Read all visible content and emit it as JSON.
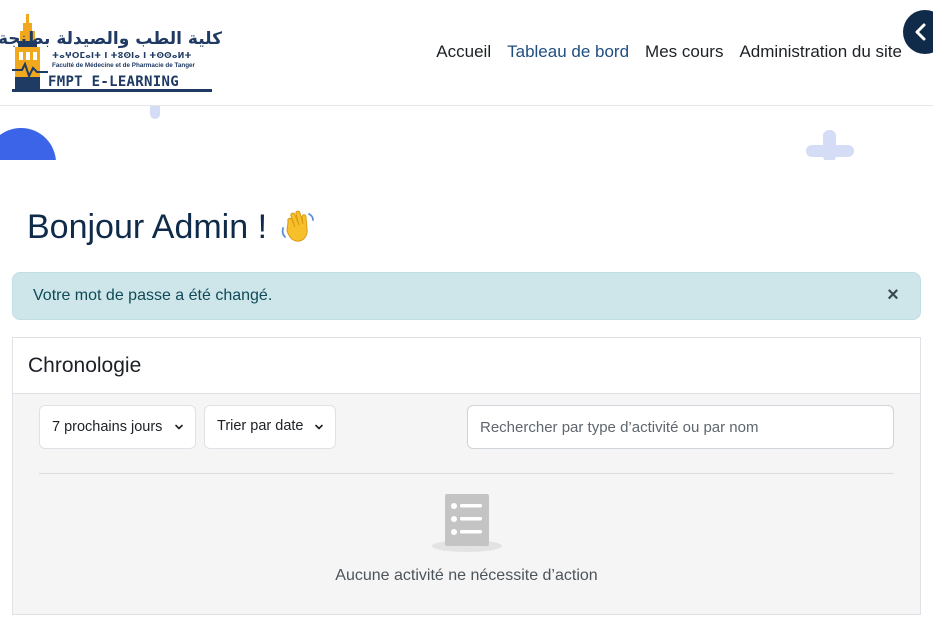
{
  "logo": {
    "arabic_name": "كلية الطب والصيدلة بطنجة",
    "tifinagh_name": "ⵜⴰⵖⵔⵎⴰⵏⵜ ⵏ ⵜⵓⵙⵏⴰ ⵏ ⵜⵙⵙⴰⵍⵜ",
    "french_name": "Faculté de Médecine et de Pharmacie de Tanger",
    "brand": "FMPT E-LEARNING"
  },
  "nav": {
    "items": [
      "Accueil",
      "Tableau de bord",
      "Mes cours",
      "Administration du site"
    ],
    "active_index": 1
  },
  "greeting": {
    "text": "Bonjour Admin !",
    "emoji": "👋"
  },
  "alert": {
    "message": "Votre mot de passe a été changé.",
    "close_label": "×"
  },
  "timeline": {
    "title": "Chronologie",
    "filter_days": "7 prochains jours",
    "sort": "Trier par date",
    "search_placeholder": "Rechercher par type d’activité ou par nom",
    "empty_message": "Aucune activité ne nécessite d’action"
  },
  "colors": {
    "brand_navy": "#0f2b49",
    "nav_active": "#1f4e80",
    "alert_bg": "#cee6ea",
    "deco_blue": "#3b64e8",
    "deco_light": "#d4dcf6"
  },
  "icons": {
    "drawer_toggle": "chevron-left-icon",
    "alert_close": "close-icon",
    "dropdown": "chevron-down-icon",
    "empty_state": "list-document-icon"
  }
}
